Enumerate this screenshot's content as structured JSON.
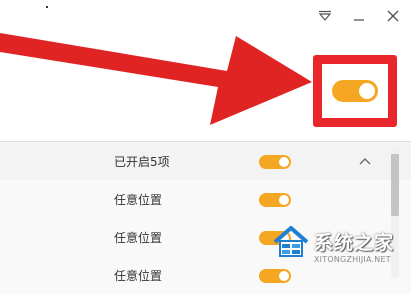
{
  "window": {
    "controls": [
      {
        "name": "dropdown-icon"
      },
      {
        "name": "minimize-icon"
      },
      {
        "name": "close-icon"
      }
    ]
  },
  "highlight": {
    "toggle_state": "on",
    "accent_color": "#f5a623",
    "box_color": "#e8262b"
  },
  "list": {
    "header": {
      "label": "已开启5项",
      "toggle_state": "on",
      "collapse_icon": "chevron-up-icon"
    },
    "rows": [
      {
        "label": "任意位置",
        "toggle_state": "on"
      },
      {
        "label": "任意位置",
        "toggle_state": "on"
      },
      {
        "label": "任意位置",
        "toggle_state": "on"
      }
    ]
  },
  "watermark": {
    "title": "系统之家",
    "url": "XITONGZHIJIA.NET"
  }
}
